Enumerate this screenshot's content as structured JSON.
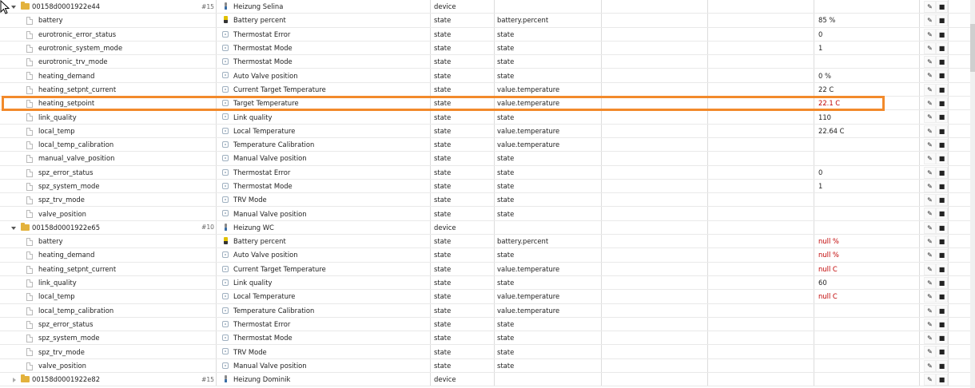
{
  "devices": [
    {
      "id": "00158d0001922e44",
      "num": "#15",
      "name": "Heizung Selina",
      "role": "device",
      "expanded": true,
      "states": [
        {
          "id": "battery",
          "name": "Battery percent",
          "icon": "battery-icon",
          "role": "state",
          "type": "battery.percent",
          "value": "85 %",
          "error": false
        },
        {
          "id": "eurotronic_error_status",
          "name": "Thermostat Error",
          "icon": "state-icon",
          "role": "state",
          "type": "state",
          "value": "0",
          "error": false
        },
        {
          "id": "eurotronic_system_mode",
          "name": "Thermostat Mode",
          "icon": "state-icon",
          "role": "state",
          "type": "state",
          "value": "1",
          "error": false
        },
        {
          "id": "eurotronic_trv_mode",
          "name": "Thermostat Mode",
          "icon": "state-icon",
          "role": "state",
          "type": "state",
          "value": "",
          "error": false
        },
        {
          "id": "heating_demand",
          "name": "Auto Valve position",
          "icon": "state-icon",
          "role": "state",
          "type": "state",
          "value": "0 %",
          "error": false
        },
        {
          "id": "heating_setpnt_current",
          "name": "Current Target Temperature",
          "icon": "state-icon",
          "role": "state",
          "type": "value.temperature",
          "value": "22 C",
          "error": false
        },
        {
          "id": "heating_setpoint",
          "name": "Target Temperature",
          "icon": "state-icon",
          "role": "state",
          "type": "value.temperature",
          "value": "22.1 C",
          "error": true
        },
        {
          "id": "link_quality",
          "name": "Link quality",
          "icon": "state-icon",
          "role": "state",
          "type": "state",
          "value": "110",
          "error": false
        },
        {
          "id": "local_temp",
          "name": "Local Temperature",
          "icon": "state-icon",
          "role": "state",
          "type": "value.temperature",
          "value": "22.64 C",
          "error": false
        },
        {
          "id": "local_temp_calibration",
          "name": "Temperature Calibration",
          "icon": "state-icon",
          "role": "state",
          "type": "value.temperature",
          "value": "",
          "error": false
        },
        {
          "id": "manual_valve_position",
          "name": "Manual Valve position",
          "icon": "state-icon",
          "role": "state",
          "type": "state",
          "value": "",
          "error": false
        },
        {
          "id": "spz_error_status",
          "name": "Thermostat Error",
          "icon": "state-icon",
          "role": "state",
          "type": "state",
          "value": "0",
          "error": false
        },
        {
          "id": "spz_system_mode",
          "name": "Thermostat Mode",
          "icon": "state-icon",
          "role": "state",
          "type": "state",
          "value": "1",
          "error": false
        },
        {
          "id": "spz_trv_mode",
          "name": "TRV Mode",
          "icon": "state-icon",
          "role": "state",
          "type": "state",
          "value": "",
          "error": false
        },
        {
          "id": "valve_position",
          "name": "Manual Valve position",
          "icon": "state-icon",
          "role": "state",
          "type": "state",
          "value": "",
          "error": false
        }
      ]
    },
    {
      "id": "00158d0001922e65",
      "num": "#10",
      "name": "Heizung WC",
      "role": "device",
      "expanded": true,
      "states": [
        {
          "id": "battery",
          "name": "Battery percent",
          "icon": "battery-icon",
          "role": "state",
          "type": "battery.percent",
          "value": "null %",
          "error": true
        },
        {
          "id": "heating_demand",
          "name": "Auto Valve position",
          "icon": "state-icon",
          "role": "state",
          "type": "state",
          "value": "null %",
          "error": true
        },
        {
          "id": "heating_setpnt_current",
          "name": "Current Target Temperature",
          "icon": "state-icon",
          "role": "state",
          "type": "value.temperature",
          "value": "null C",
          "error": true
        },
        {
          "id": "link_quality",
          "name": "Link quality",
          "icon": "state-icon",
          "role": "state",
          "type": "state",
          "value": "60",
          "error": false
        },
        {
          "id": "local_temp",
          "name": "Local Temperature",
          "icon": "state-icon",
          "role": "state",
          "type": "value.temperature",
          "value": "null C",
          "error": true
        },
        {
          "id": "local_temp_calibration",
          "name": "Temperature Calibration",
          "icon": "state-icon",
          "role": "state",
          "type": "value.temperature",
          "value": "",
          "error": false
        },
        {
          "id": "spz_error_status",
          "name": "Thermostat Error",
          "icon": "state-icon",
          "role": "state",
          "type": "state",
          "value": "",
          "error": false
        },
        {
          "id": "spz_system_mode",
          "name": "Thermostat Mode",
          "icon": "state-icon",
          "role": "state",
          "type": "state",
          "value": "",
          "error": false
        },
        {
          "id": "spz_trv_mode",
          "name": "TRV Mode",
          "icon": "state-icon",
          "role": "state",
          "type": "state",
          "value": "",
          "error": false
        },
        {
          "id": "valve_position",
          "name": "Manual Valve position",
          "icon": "state-icon",
          "role": "state",
          "type": "state",
          "value": "",
          "error": false
        }
      ]
    },
    {
      "id": "00158d0001922e82",
      "num": "#15",
      "name": "Heizung Dominik",
      "role": "device",
      "expanded": false,
      "states": []
    }
  ],
  "actions": {
    "edit_icon": "edit-icon",
    "delete_icon": "delete-icon",
    "edit_glyph": "✎",
    "delete_glyph": "■"
  },
  "highlight": {
    "row_id": "heating_setpoint",
    "color": "#f28a2b"
  },
  "colors": {
    "error_value": "#c00000",
    "folder": "#e3b23c"
  }
}
